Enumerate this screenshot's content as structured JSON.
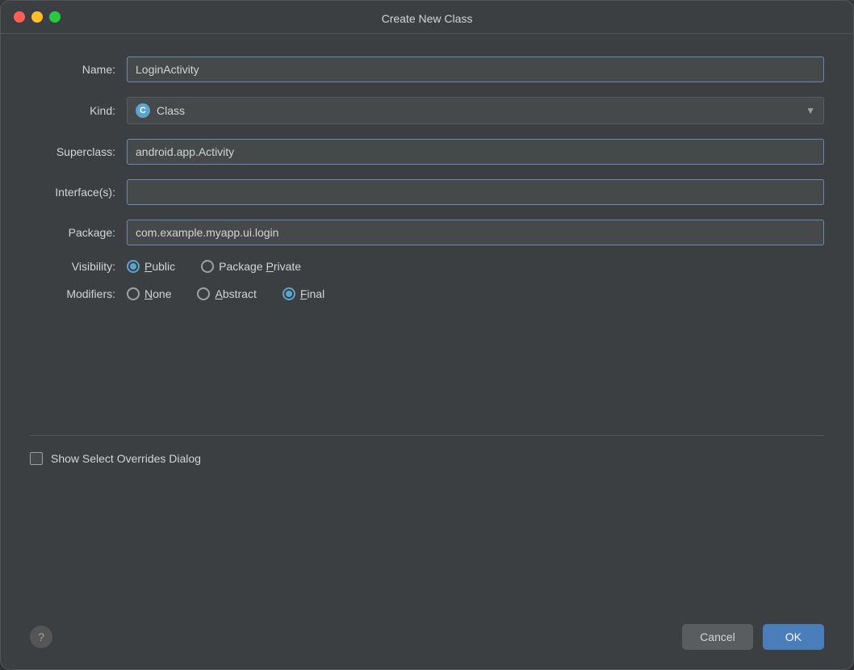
{
  "dialog": {
    "title": "Create New Class",
    "fields": {
      "name_label": "Name:",
      "name_value": "LoginActivity",
      "kind_label": "Kind:",
      "kind_value": "Class",
      "kind_icon_letter": "C",
      "superclass_label": "Superclass:",
      "superclass_value": "android.app.Activity",
      "interfaces_label": "Interface(s):",
      "interfaces_value": "",
      "package_label": "Package:",
      "package_value": "com.example.myapp.ui.login",
      "visibility_label": "Visibility:",
      "modifiers_label": "Modifiers:"
    },
    "visibility_options": [
      {
        "label": "Public",
        "checked": true
      },
      {
        "label": "Package Private",
        "checked": false,
        "underline_index": 8
      }
    ],
    "modifiers_options": [
      {
        "label": "None",
        "checked": false
      },
      {
        "label": "Abstract",
        "checked": false
      },
      {
        "label": "Final",
        "checked": true
      }
    ],
    "checkbox": {
      "label": "Show Select Overrides Dialog",
      "checked": false
    },
    "buttons": {
      "help": "?",
      "cancel": "Cancel",
      "ok": "OK"
    }
  }
}
